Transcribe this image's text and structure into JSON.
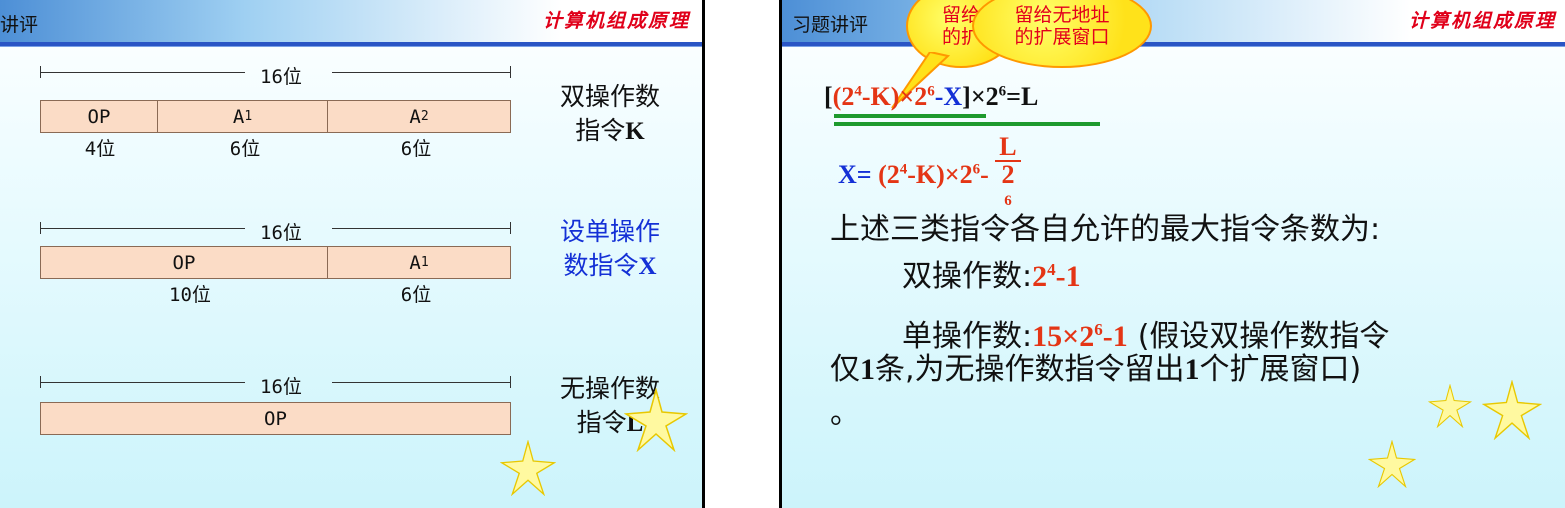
{
  "left_slide": {
    "header_title": "讲评",
    "brand": "计算机组成原理",
    "formats": [
      {
        "width_label": "16位",
        "fields": [
          {
            "name": "OP",
            "sub": "",
            "size": "4位"
          },
          {
            "name": "A",
            "sub": "1",
            "size": "6位"
          },
          {
            "name": "A",
            "sub": "2",
            "size": "6位"
          }
        ],
        "desc_line1": "双操作数",
        "desc_line2_text": "指令",
        "desc_line2_var": "K"
      },
      {
        "width_label": "16位",
        "fields": [
          {
            "name": "OP",
            "sub": "",
            "size": "10位"
          },
          {
            "name": "A",
            "sub": "1",
            "size": "6位"
          }
        ],
        "desc_line1": "设单操作",
        "desc_line2_text": "数指令",
        "desc_line2_var": "X"
      },
      {
        "width_label": "16位",
        "fields": [
          {
            "name": "OP",
            "sub": "",
            "size": ""
          }
        ],
        "desc_line1": "无操作数",
        "desc_line2_text": "指令",
        "desc_line2_var": "L"
      }
    ]
  },
  "right_slide": {
    "header_title": "习题讲评",
    "brand": "计算机组成原理",
    "callouts": [
      {
        "line1": "留给",
        "line2": "的扩"
      },
      {
        "line1": "留给无地址",
        "line2": "的扩展窗口"
      }
    ],
    "formula1": {
      "open": "[",
      "paren_open": "(2",
      "exp_4": "4",
      "minus_k": "-K)",
      "times": "×2",
      "exp_6": "6",
      "minus_x": "-X",
      "close": "]×2",
      "exp_6b": "6",
      "equals": "=L"
    },
    "formula2": {
      "lhs": "X=",
      "term": "(2",
      "exp_4": "4",
      "minus_k": "-K)×2",
      "exp_6": "6",
      "minus": "-",
      "frac_num": "L",
      "frac_den_base": "2",
      "frac_den_exp": "6"
    },
    "line_intro": "上述三类指令各自允许的最大指令条数为:",
    "line_double_label": "双操作数:",
    "line_double_value_base": "2",
    "line_double_value_exp": "4",
    "line_double_value_tail": "-1",
    "line_single_label": "单操作数:",
    "line_single_value_pre": "15×2",
    "line_single_value_exp": "6",
    "line_single_value_tail": "-1",
    "line_single_note": "(假设双操作数指令",
    "line_note2_a": "仅",
    "line_note2_one": "1",
    "line_note2_b": "条,为无操作数指令留出",
    "line_note2_one2": "1",
    "line_note2_c": "个扩展窗口)",
    "line_period": "。"
  },
  "colors": {
    "header_blue": "#2a55c5",
    "brand_red": "#e0001a",
    "field_fill": "#fbdcc6",
    "formula_red": "#e43515",
    "formula_blue": "#1430d6",
    "underline_green": "#1e9a2e"
  }
}
